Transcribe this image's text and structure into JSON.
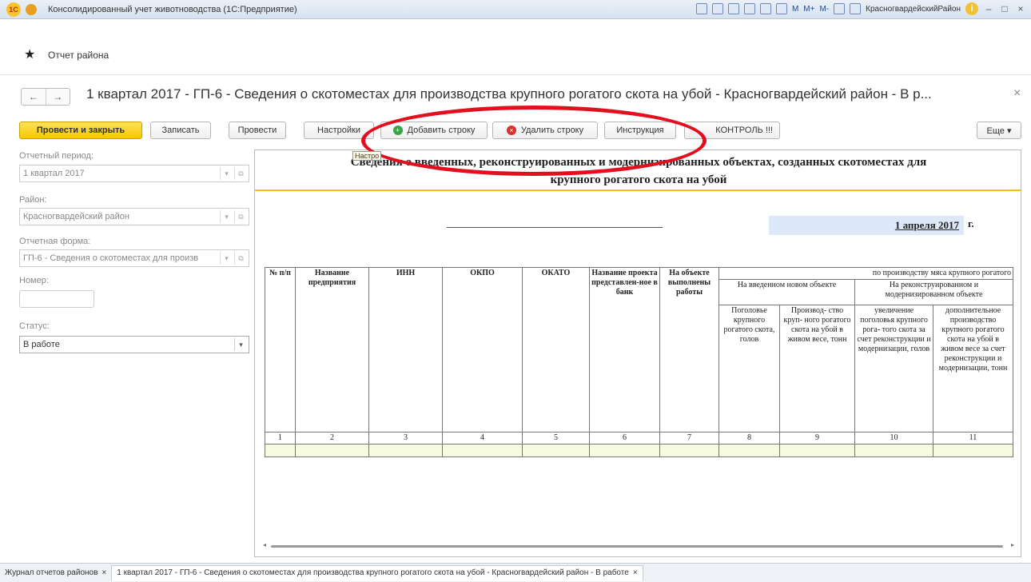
{
  "titlebar": {
    "title": "Консолидированный учет животноводства (1С:Предприятие)",
    "m_label": "M",
    "mplus_label": "M+",
    "mminus_label": "M-",
    "user": "КрасногвардейскийРайон",
    "min": "–",
    "restore": "□",
    "close": "×"
  },
  "crumb": {
    "star": "★",
    "text": "Отчет района"
  },
  "document": {
    "back": "←",
    "forward": "→",
    "title": "1 квартал 2017 - ГП-6 - Сведения о скотоместах для производства крупного рогатого скота на убой - Красногвардейский район - В р...",
    "close": "×"
  },
  "toolbar": {
    "post_close": "Провести и закрыть",
    "save": "Записать",
    "post": "Провести",
    "settings": "Настройки",
    "add_row": "Добавить строку",
    "delete_row": "Удалить строку",
    "instruction": "Инструкция",
    "control": "КОНТРОЛЬ !!!",
    "more": "Еще ▾",
    "tooltip": "Настро"
  },
  "form": {
    "period_label": "Отчетный период:",
    "period_value": "1 квартал 2017",
    "district_label": "Район:",
    "district_value": "Красногвардейский район",
    "report_form_label": "Отчетная форма:",
    "report_form_value": "ГП-6 - Сведения о скотоместах для произв",
    "number_label": "Номер:",
    "status_label": "Статус:",
    "status_value": "В работе"
  },
  "sheet": {
    "title_line1": "Сведения о введенных, реконструированных и модернизированных объектах, созданных скотоместах для",
    "title_line2": "крупного рогатого скота на убой",
    "date": "1 апреля 2017",
    "date_suffix": "г.",
    "headers": {
      "c1": "№ п/п",
      "c2": "Название предприятия",
      "c3": "ИНН",
      "c4": "ОКПО",
      "c5": "ОКАТО",
      "c6": "Название проекта представлен-ное в банк",
      "c7": "На объекте выполнены работы",
      "group_top": "по производству мяса крупного рогатого",
      "group_new": "На введенном новом объекте",
      "group_recon": "На реконструированном и модернизированном объекте",
      "c8": "Поголовье крупного рогатого скота, голов",
      "c9": "Производ- ство круп- ного рогатого скота на убой в живом весе, тонн",
      "c10": "увеличение поголовья крупного рога- того скота за счет реконструкции и модернизации, голов",
      "c11": "дополнительное производство крупного рогатого скота на убой в живом весе за счет реконструкции и модернизации, тонн"
    },
    "col_numbers": [
      "1",
      "2",
      "3",
      "4",
      "5",
      "6",
      "7",
      "8",
      "9",
      "10",
      "11"
    ]
  },
  "tabs": {
    "tab1": "Журнал отчетов районов",
    "tab2": "1 квартал 2017 - ГП-6 - Сведения о скотоместах для производства крупного рогатого скота на убой - Красногвардейский район - В работе",
    "close": "×"
  },
  "colors": {
    "accent": "#f5c800",
    "annotation": "#e20f1e",
    "date_bg": "#dde9f9"
  }
}
